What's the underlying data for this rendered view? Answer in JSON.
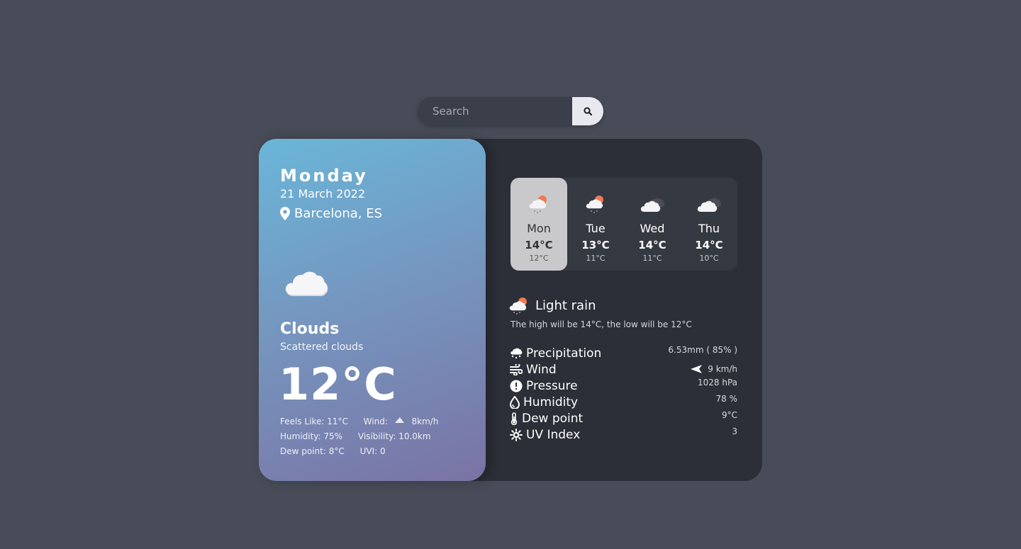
{
  "search": {
    "placeholder": "Search"
  },
  "today": {
    "day": "Monday",
    "date": "21 March 2022",
    "location": "Barcelona, ES",
    "condition": "Clouds",
    "description": "Scattered clouds",
    "temperature": "12°C",
    "stats": {
      "feels_like": "Feels Like: 11°C",
      "wind_label": "Wind:",
      "wind_value": "8km/h",
      "humidity": "Humidity: 75%",
      "visibility": "Visibility: 10.0km",
      "dew_point": "Dew point: 8°C",
      "uvi": "UVI: 0"
    }
  },
  "forecast": [
    {
      "day": "Mon",
      "high": "14°C",
      "low": "12°C",
      "icon": "rain-sun-cloud-icon",
      "selected": true
    },
    {
      "day": "Tue",
      "high": "13°C",
      "low": "11°C",
      "icon": "rain-sun-cloud-icon",
      "selected": false
    },
    {
      "day": "Wed",
      "high": "14°C",
      "low": "11°C",
      "icon": "cloud-icon",
      "selected": false
    },
    {
      "day": "Thu",
      "high": "14°C",
      "low": "10°C",
      "icon": "cloud-icon",
      "selected": false
    }
  ],
  "detail": {
    "title": "Light rain",
    "summary": "The high will be 14°C, the low will be 12°C",
    "rows": [
      {
        "label": "Precipitation",
        "value": "6.53mm ( 85% )",
        "icon": "precipitation-icon"
      },
      {
        "label": "Wind",
        "value": "9 km/h",
        "icon": "wind-icon"
      },
      {
        "label": "Pressure",
        "value": "1028 hPa",
        "icon": "pressure-icon"
      },
      {
        "label": "Humidity",
        "value": "78 %",
        "icon": "humidity-icon"
      },
      {
        "label": "Dew point",
        "value": "9°C",
        "icon": "thermometer-icon"
      },
      {
        "label": "UV Index",
        "value": "3",
        "icon": "uv-icon"
      }
    ]
  },
  "colors": {
    "background": "#474c58",
    "panel": "#2c2f37",
    "selected_day": "#c9c9cc",
    "sun": "#f07a55"
  }
}
